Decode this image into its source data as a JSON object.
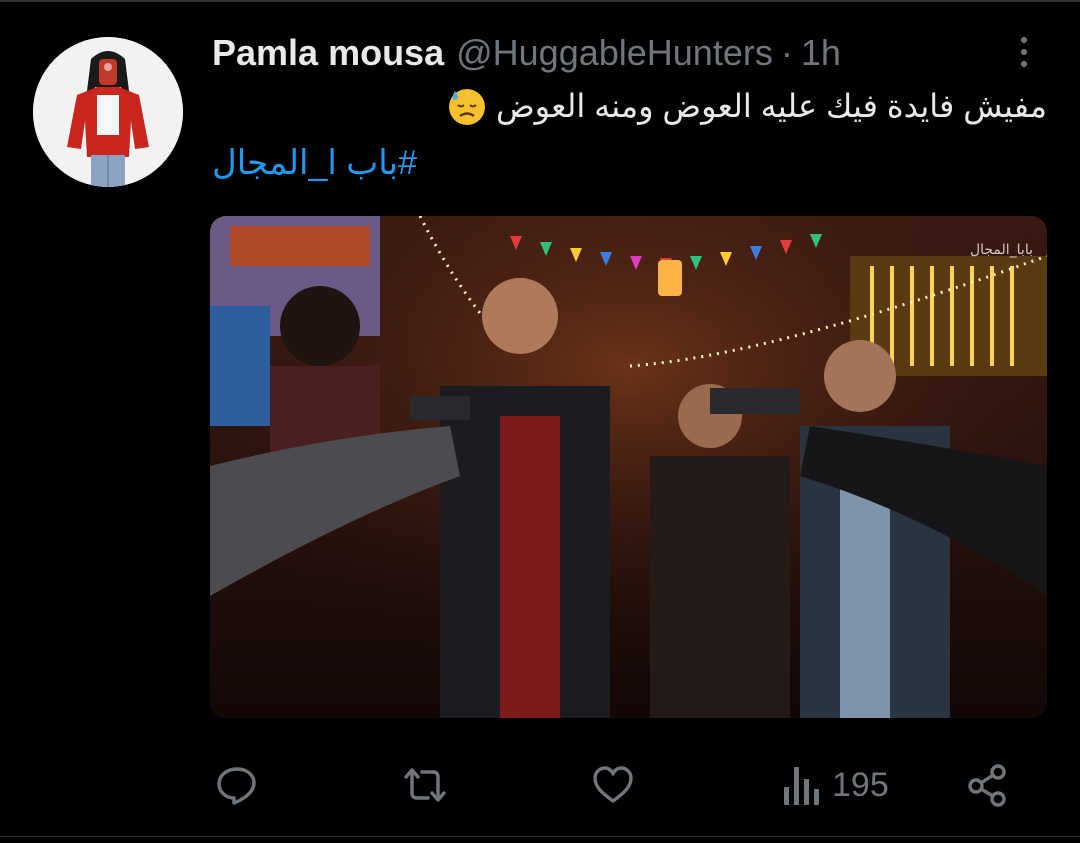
{
  "tweet": {
    "display_name": "Pamla mousa",
    "handle": "@HuggableHunters",
    "separator": "·",
    "time": "1h",
    "text": "مفيش فايدة فيك عليه العوض ومنه العوض",
    "emoji": "downcast-face-with-sweat",
    "hashtag": "#باب ا_المجال",
    "media": {
      "watermark": "بابا_المجال"
    }
  },
  "actions": {
    "reply": {
      "icon": "reply-icon"
    },
    "retweet": {
      "icon": "retweet-icon"
    },
    "like": {
      "icon": "heart-icon"
    },
    "views": {
      "icon": "views-icon",
      "count": "195"
    },
    "share": {
      "icon": "share-icon"
    }
  },
  "colors": {
    "background": "#000000",
    "text_primary": "#e7e9ea",
    "text_secondary": "#71767b",
    "link": "#1d9bf0"
  }
}
